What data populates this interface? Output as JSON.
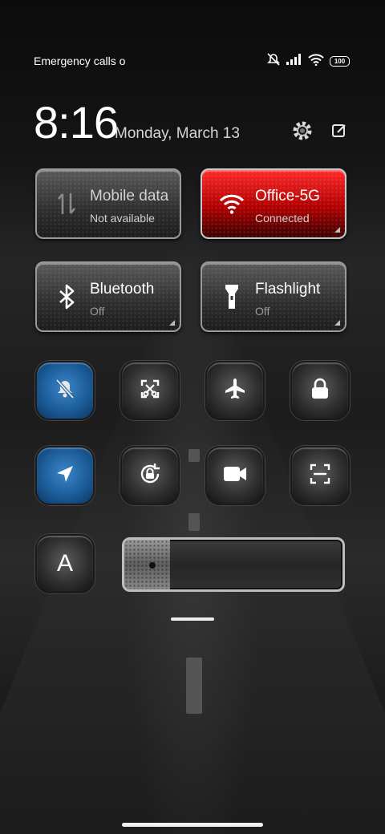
{
  "status_bar": {
    "carrier_text": "Emergency calls o",
    "icons": [
      "mute-icon",
      "signal-icon",
      "wifi-icon",
      "battery-icon"
    ],
    "battery_label": "100"
  },
  "header": {
    "time": "8:16",
    "date": "Monday, March 13",
    "icons": [
      "settings-icon",
      "edit-icon"
    ]
  },
  "tiles": [
    {
      "title": "Mobile data",
      "status": "Not available",
      "icon": "mobile-data-icon",
      "active": false
    },
    {
      "title": "Office-5G",
      "status": "Connected",
      "icon": "wifi-icon",
      "active": true
    },
    {
      "title": "Bluetooth",
      "status": "Off",
      "icon": "bluetooth-icon",
      "active": false
    },
    {
      "title": "Flashlight",
      "status": "Off",
      "icon": "flashlight-icon",
      "active": false
    }
  ],
  "toggles": [
    {
      "icon": "mute-bell-icon",
      "active": true
    },
    {
      "icon": "screenshot-icon",
      "active": false
    },
    {
      "icon": "airplane-icon",
      "active": false
    },
    {
      "icon": "lock-icon",
      "active": false
    },
    {
      "icon": "location-icon",
      "active": true
    },
    {
      "icon": "rotation-lock-icon",
      "active": false
    },
    {
      "icon": "video-camera-icon",
      "active": false
    },
    {
      "icon": "scanner-icon",
      "active": false
    },
    {
      "icon": "font-icon",
      "label": "A",
      "active": false
    }
  ],
  "brightness": {
    "level": 0.21
  },
  "colors": {
    "active_blue": "#1c5d9a",
    "wifi_red": "#c00000"
  }
}
